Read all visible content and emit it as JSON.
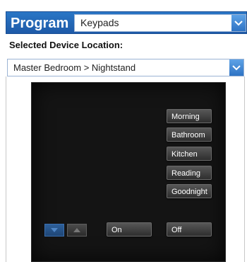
{
  "header": {
    "title": "Program",
    "program_select": {
      "value": "Keypads"
    }
  },
  "device_location": {
    "label": "Selected Device Location:",
    "value": "Master Bedroom > Nightstand"
  },
  "keypad": {
    "scene_buttons": [
      "Morning",
      "Bathroom",
      "Kitchen",
      "Reading",
      "Goodnight"
    ],
    "on_label": "On",
    "off_label": "Off",
    "nav": {
      "down_icon": "chevron-down-icon",
      "up_icon": "chevron-up-icon"
    }
  },
  "colors": {
    "header_blue": "#1e5aa8",
    "dropdown_blue": "#2e73c4",
    "keypad_background": "#141414",
    "nav_active": "#2d5f99"
  }
}
